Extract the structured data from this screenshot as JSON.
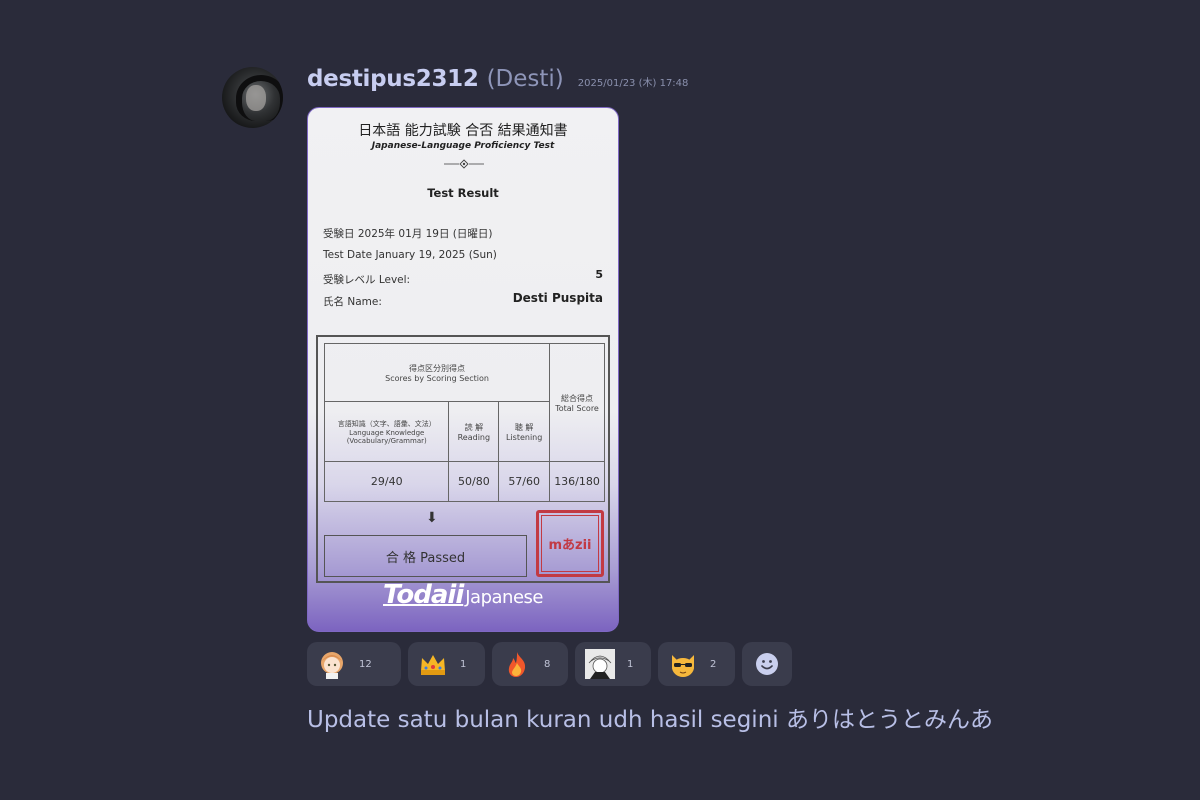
{
  "message": {
    "username": "destipus2312",
    "display_name": "(Desti)",
    "timestamp": "2025/01/23 (木) 17:48",
    "text": "Update satu bulan kuran udh hasil segini ありはとうとみんあ"
  },
  "certificate": {
    "title_jp": "日本語 能力試験 合否 結果通知書",
    "title_en": "Japanese-Language Proficiency Test",
    "result_heading": "Test Result",
    "date_jp": "受験日 2025年 01月 19日 (日曜日)",
    "date_en": "Test Date January 19, 2025 (Sun)",
    "level_label": "受験レベル Level:",
    "level_value": "5",
    "name_label": "氏名 Name:",
    "name_value": "Desti Puspita",
    "table": {
      "section_jp": "得点区分別得点",
      "section_en": "Scores by Scoring Section",
      "total_jp": "総合得点",
      "total_en": "Total Score",
      "lang_jp": "言語知識（文字、語彙、文法）",
      "lang_en": "Language Knowledge",
      "lang_en2": "(Vocabulary/Grammar)",
      "reading_jp": "読 解",
      "reading_en": "Reading",
      "listening_jp": "聴 解",
      "listening_en": "Listening",
      "score_lang": "29/40",
      "score_reading": "50/80",
      "score_listening": "57/60",
      "score_total": "136/180"
    },
    "passed": "合 格 Passed",
    "stamp": "mあzii",
    "brand_main": "Todaii",
    "brand_sub": "Japanese"
  },
  "reactions": [
    {
      "emoji": "anime-girl",
      "count": "12"
    },
    {
      "emoji": "crown",
      "count": "1"
    },
    {
      "emoji": "fire",
      "count": "8"
    },
    {
      "emoji": "anime-boy",
      "count": "1"
    },
    {
      "emoji": "cool-cat",
      "count": "2"
    }
  ],
  "colors": {
    "background": "#2a2b3a",
    "username": "#c7cdf0",
    "reaction_bg": "#3a3c4c",
    "card_accent": "#7c64c0",
    "stamp_red": "#c23a43"
  }
}
